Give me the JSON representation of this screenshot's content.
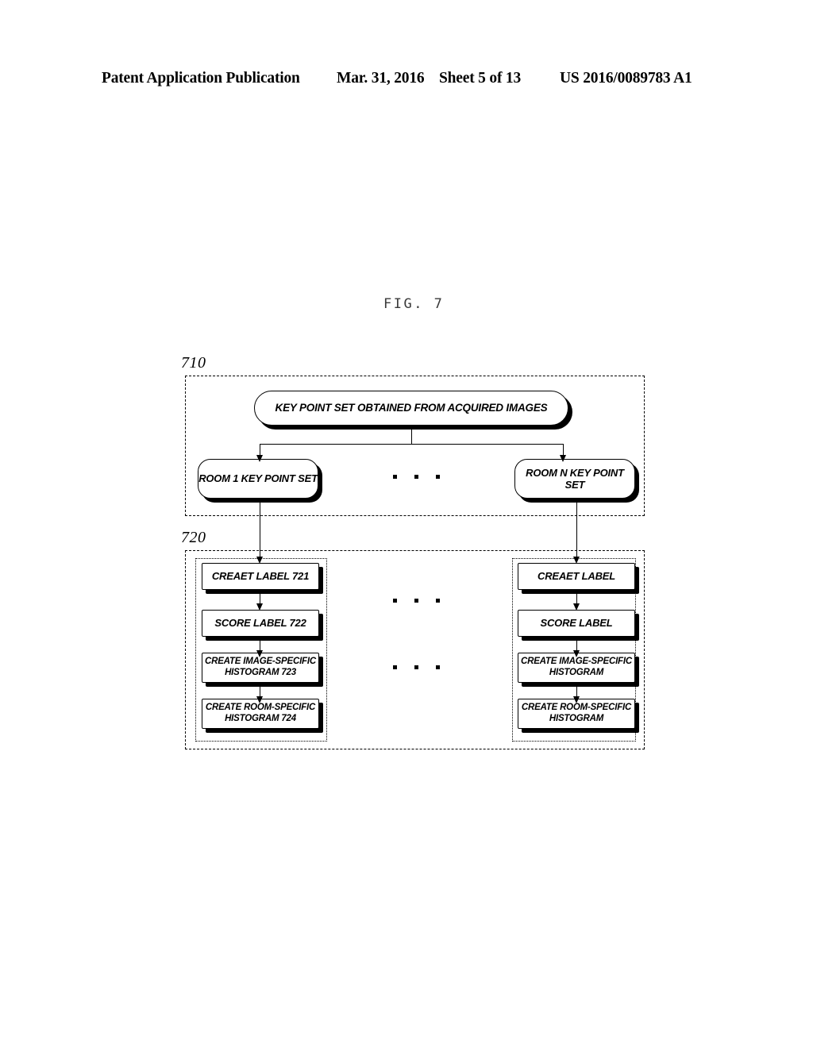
{
  "header": {
    "publication": "Patent Application Publication",
    "date": "Mar. 31, 2016",
    "sheet": "Sheet 5 of 13",
    "number": "US 2016/0089783 A1"
  },
  "figure": {
    "title": "FIG. 7",
    "groups": [
      {
        "ref": "710"
      },
      {
        "ref": "720"
      }
    ],
    "top_node": {
      "label": "KEY POINT SET OBTAINED FROM ACQUIRED IMAGES"
    },
    "room_nodes": [
      {
        "label": "ROOM 1 KEY POINT SET"
      },
      {
        "label": "ROOM N KEY POINT SET"
      }
    ],
    "ellipsis_glyph": "• • •",
    "pipelines": [
      {
        "name": "room-1-pipeline",
        "steps": [
          {
            "line1": "CREAET LABEL 721",
            "line2": ""
          },
          {
            "line1": "SCORE LABEL 722",
            "line2": ""
          },
          {
            "line1": "CREATE IMAGE-SPECIFIC",
            "line2": "HISTOGRAM 723"
          },
          {
            "line1": "CREATE ROOM-SPECIFIC",
            "line2": "HISTOGRAM 724"
          }
        ]
      },
      {
        "name": "room-n-pipeline",
        "steps": [
          {
            "line1": "CREAET LABEL",
            "line2": ""
          },
          {
            "line1": "SCORE LABEL",
            "line2": ""
          },
          {
            "line1": "CREATE IMAGE-SPECIFIC",
            "line2": "HISTOGRAM"
          },
          {
            "line1": "CREATE ROOM-SPECIFIC",
            "line2": "HISTOGRAM"
          }
        ]
      }
    ]
  },
  "colors": {
    "ink": "#000000",
    "paper": "#ffffff"
  }
}
